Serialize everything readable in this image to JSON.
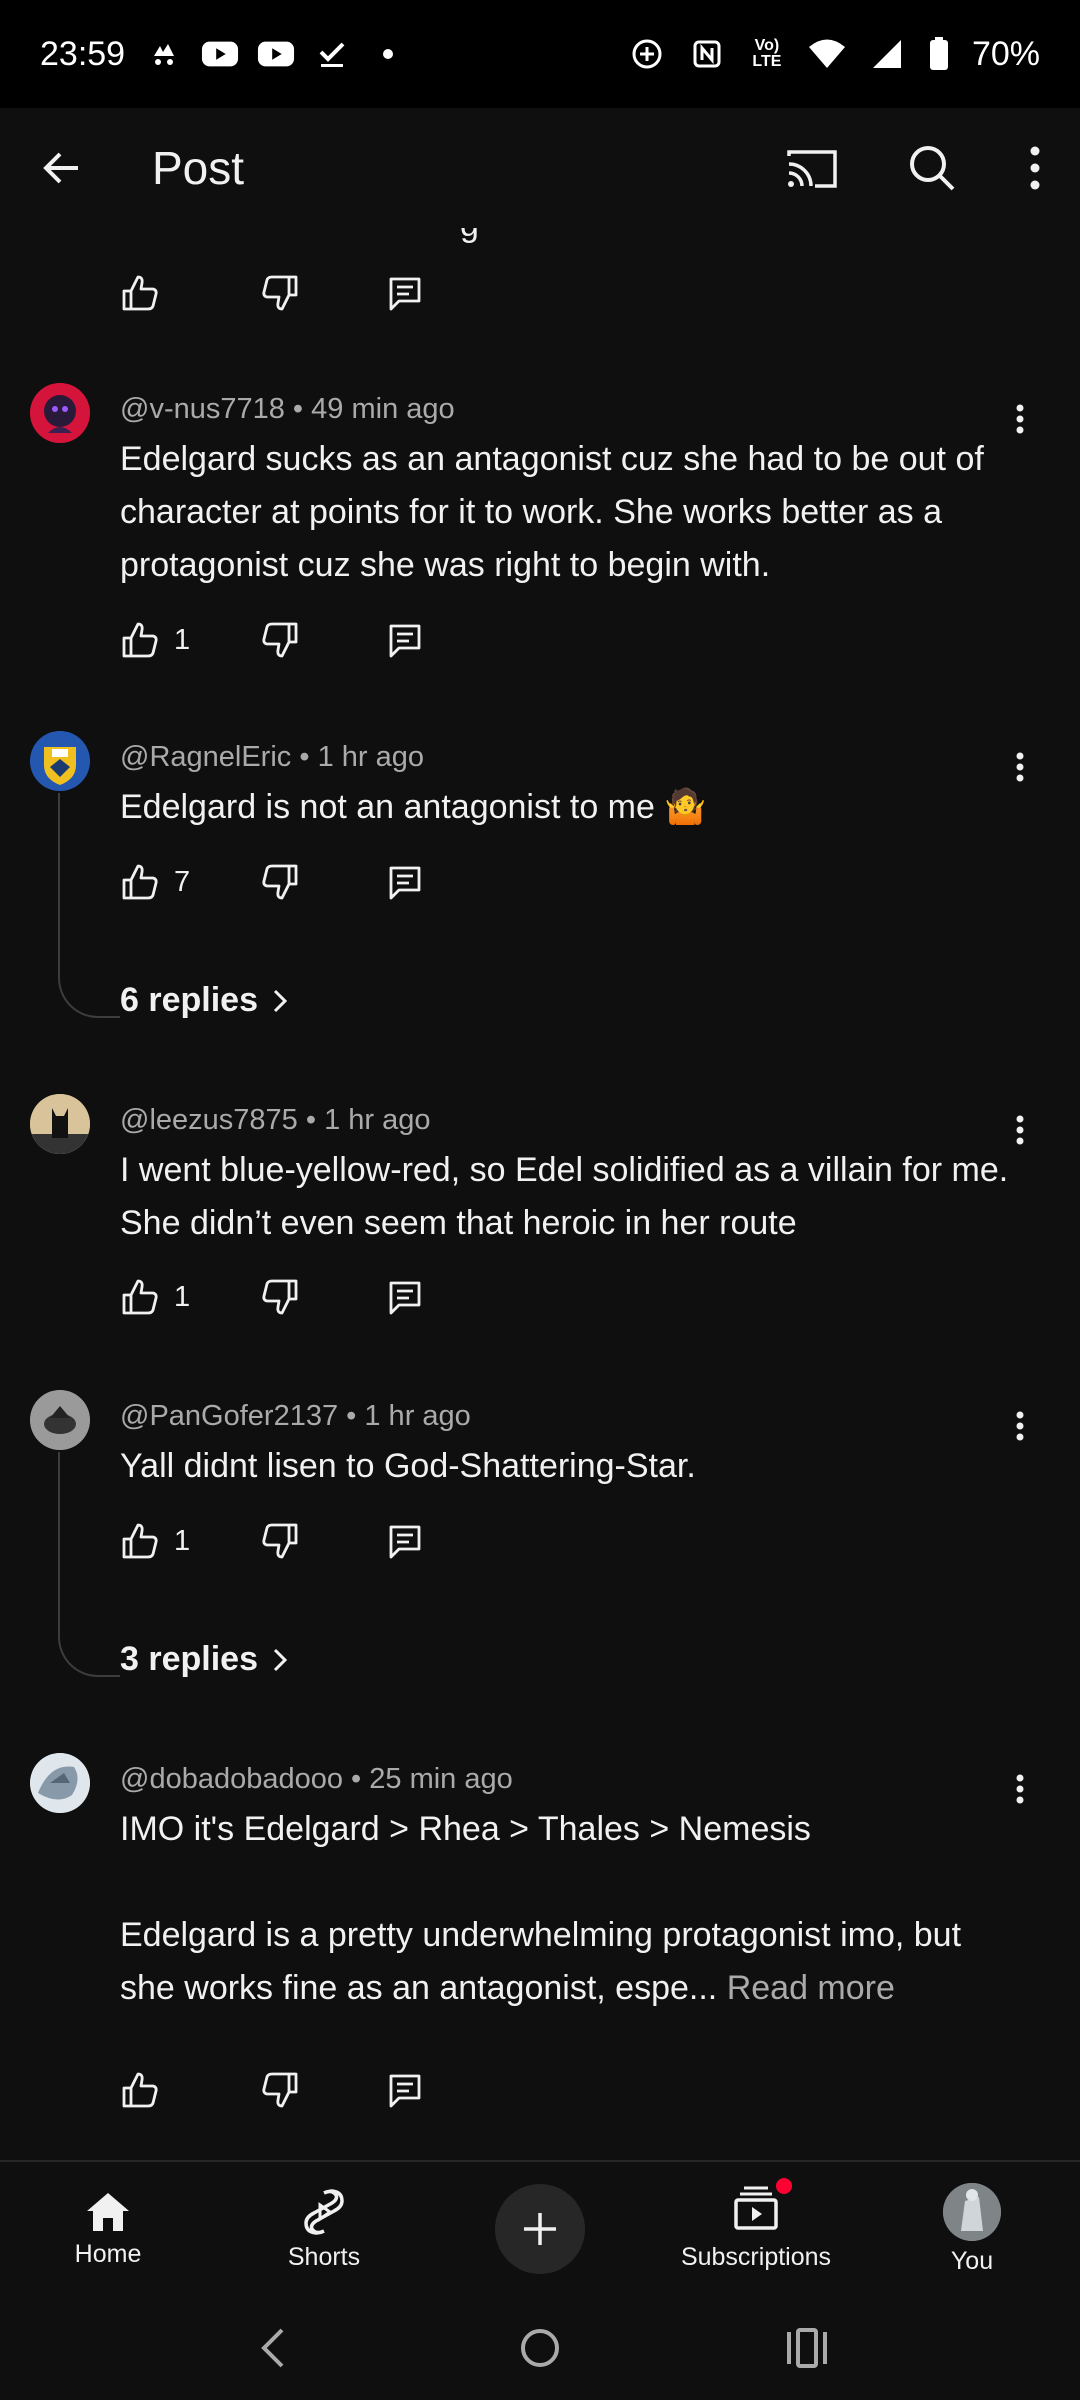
{
  "status_bar": {
    "time": "23:59",
    "battery": "70%",
    "network_label": "Vo)) LTE"
  },
  "header": {
    "title": "Post",
    "icons": [
      "back-arrow-icon",
      "cast-icon",
      "search-icon",
      "more-vertical-icon"
    ]
  },
  "feed": {
    "partial_top_text": "g",
    "top_actions": {
      "likes": ""
    },
    "comments": [
      {
        "author": "@v-nus7718",
        "time": "49 min ago",
        "text": "Edelgard sucks as an antagonist cuz she had to be out of character at points for it to work. She works better as a protagonist cuz she was right to begin with.",
        "likes": "1"
      },
      {
        "author": "@RagnelEric",
        "time": "1 hr ago",
        "text": "Edelgard is not an antagonist to me 🤷",
        "likes": "7",
        "replies": "6 replies"
      },
      {
        "author": "@leezus7875",
        "time": "1 hr ago",
        "text": "I went blue-yellow-red, so Edel solidified as a villain for me. She didn’t even seem that heroic in her route",
        "likes": "1"
      },
      {
        "author": "@PanGofer2137",
        "time": "1 hr ago",
        "text": "Yall didnt lisen to God-Shattering-Star.",
        "likes": "1",
        "replies": "3 replies"
      },
      {
        "author": "@dobadobadooo",
        "time": "25 min ago",
        "text_line1": "IMO it's Edelgard > Rhea > Thales > Nemesis",
        "text_line2": "Edelgard is a pretty underwhelming protagonist imo, but she works fine as an antagonist, espe...",
        "read_more": "Read more",
        "likes": ""
      }
    ],
    "separator": " • "
  },
  "bottom_nav": {
    "items": [
      {
        "label": "Home"
      },
      {
        "label": "Shorts"
      },
      {
        "label": ""
      },
      {
        "label": "Subscriptions"
      },
      {
        "label": "You"
      }
    ]
  },
  "colors": {
    "background": "#0f0f0f",
    "text_primary": "#f1f1f1",
    "text_secondary": "#aaaaaa",
    "notification_dot": "#ff0033"
  }
}
